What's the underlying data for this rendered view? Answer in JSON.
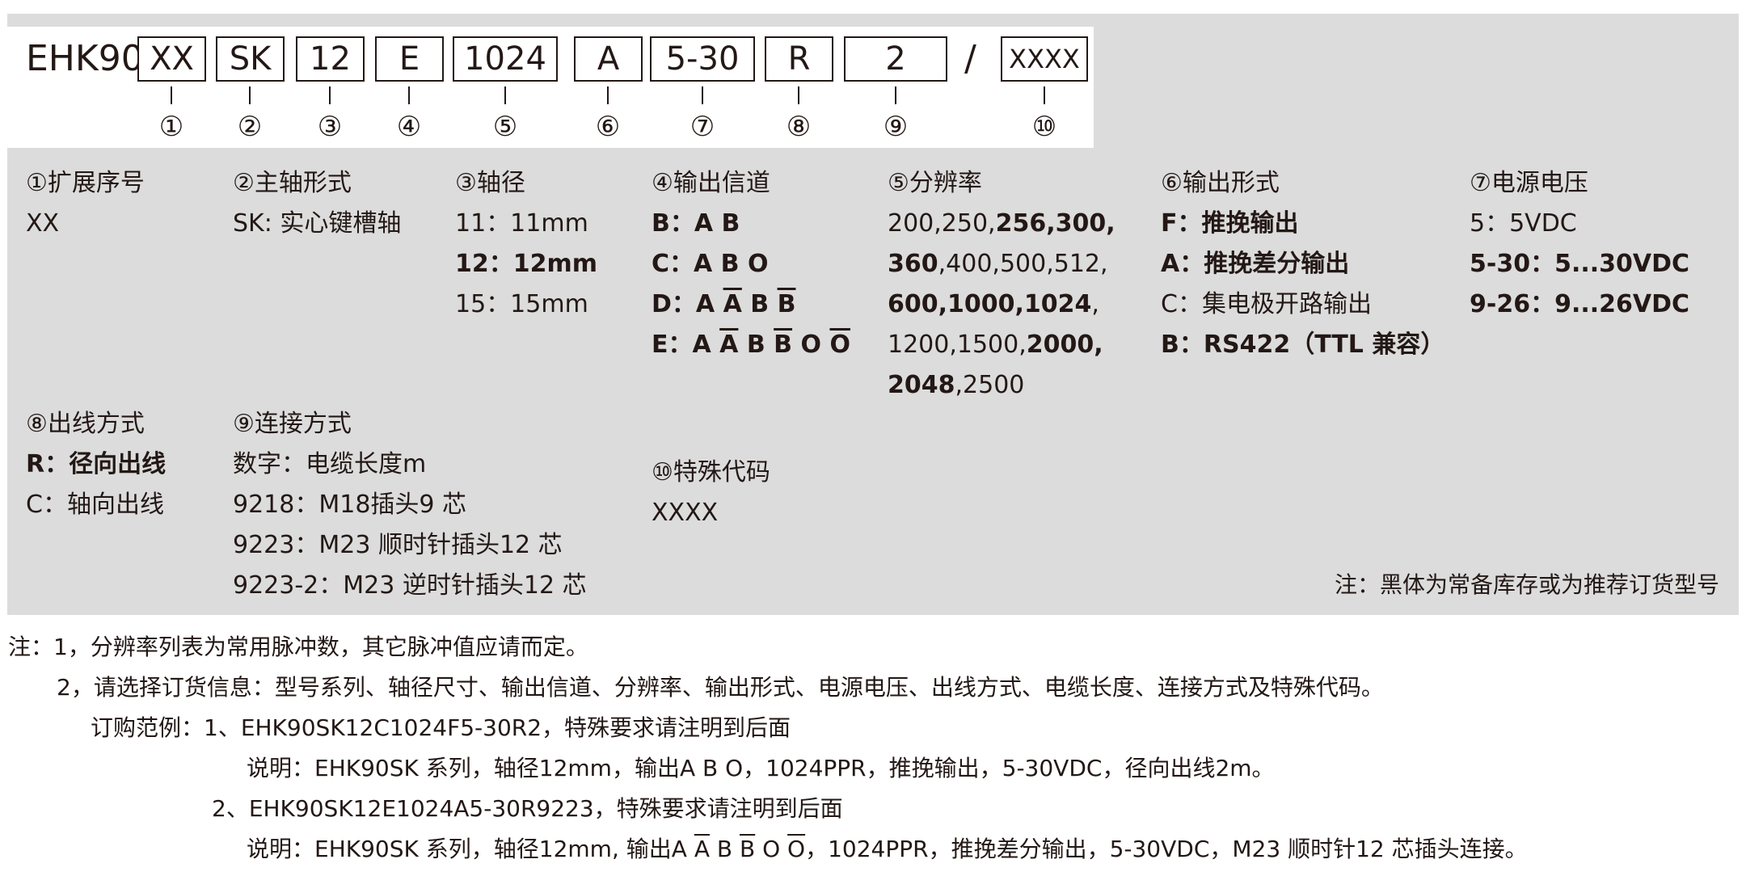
{
  "code": {
    "prefix": "EHK90",
    "boxes": [
      "XX",
      "SK",
      "12",
      "E",
      "1024",
      "A",
      "5-30",
      "R",
      "2",
      "XXXX"
    ],
    "separator": "/",
    "markers": [
      "①",
      "②",
      "③",
      "④",
      "⑤",
      "⑥",
      "⑦",
      "⑧",
      "⑨",
      "⑩"
    ]
  },
  "sections": {
    "ext": {
      "title": "①扩展序号",
      "items": [
        "XX"
      ]
    },
    "shaft_type": {
      "title": "②主轴形式",
      "items": [
        "SK: 实心键槽轴"
      ]
    },
    "shaft_dia": {
      "title": "③轴径",
      "items": [
        "11：11mm",
        "12：12mm",
        "15：15mm"
      ]
    },
    "channels": {
      "title": "④输出信道",
      "b": "B：A B",
      "c": "C：A B O",
      "d_pre": "D：A ",
      "a_bar": "A",
      "b_plain": "B",
      "b_bar": "B",
      "e_pre": "E：A ",
      "o_plain": "O",
      "o_bar": "O"
    },
    "resolution": {
      "title": "⑤分辨率",
      "r1a": "200,250,",
      "r1b": "256,300,",
      "r2a": "360",
      "r2b": ",400,500,512,",
      "r3a": "600,1000,1024",
      "r3b": ",",
      "r4a": "1200,1500,",
      "r4b": "2000,",
      "r5a": "2048",
      "r5b": ",2500"
    },
    "output": {
      "title": "⑥输出形式",
      "items": [
        "F：推挽输出",
        "A：推挽差分输出",
        "C：集电极开路输出",
        "B：RS422（TTL 兼容）"
      ]
    },
    "voltage": {
      "title": "⑦电源电压",
      "items": [
        "5：5VDC",
        "5-30：5...30VDC",
        "9-26：9...26VDC"
      ]
    },
    "cable": {
      "title": "⑧出线方式",
      "items": [
        "R：径向出线",
        "C：轴向出线"
      ]
    },
    "connection": {
      "title": "⑨连接方式",
      "items": [
        "数字：电缆长度m",
        "9218：M18插头9 芯",
        "9223：M23 顺时针插头12 芯",
        "9223-2：M23 逆时针插头12 芯"
      ]
    },
    "special": {
      "title": "⑩特殊代码",
      "items": [
        "XXXX"
      ]
    }
  },
  "panel_note": "注：黑体为常备库存或为推荐订货型号",
  "notes": {
    "n1": "注：1，分辨率列表为常用脉冲数，其它脉冲值应请而定。",
    "n2": "2，请选择订货信息：型号系列、轴径尺寸、输出信道、分辨率、输出形式、电源电压、出线方式、电缆长度、连接方式及特殊代码。",
    "n3": "订购范例：1、EHK90SK12C1024F5-30R2，特殊要求请注明到后面",
    "n4": "说明：EHK90SK 系列，轴径12mm，输出A B O，1024PPR，推挽输出，5-30VDC，径向出线2m。",
    "n5": "2、EHK90SK12E1024A5-30R9223，特殊要求请注明到后面",
    "n6_pre": "说明：EHK90SK 系列，轴径12mm, 输出A ",
    "n6_a_bar": "A",
    "n6_b": " B ",
    "n6_b_bar": "B",
    "n6_o": " O ",
    "n6_o_bar": "O",
    "n6_post": "，1024PPR，推挽差分输出，5-30VDC，M23 顺时针12 芯插头连接。"
  }
}
